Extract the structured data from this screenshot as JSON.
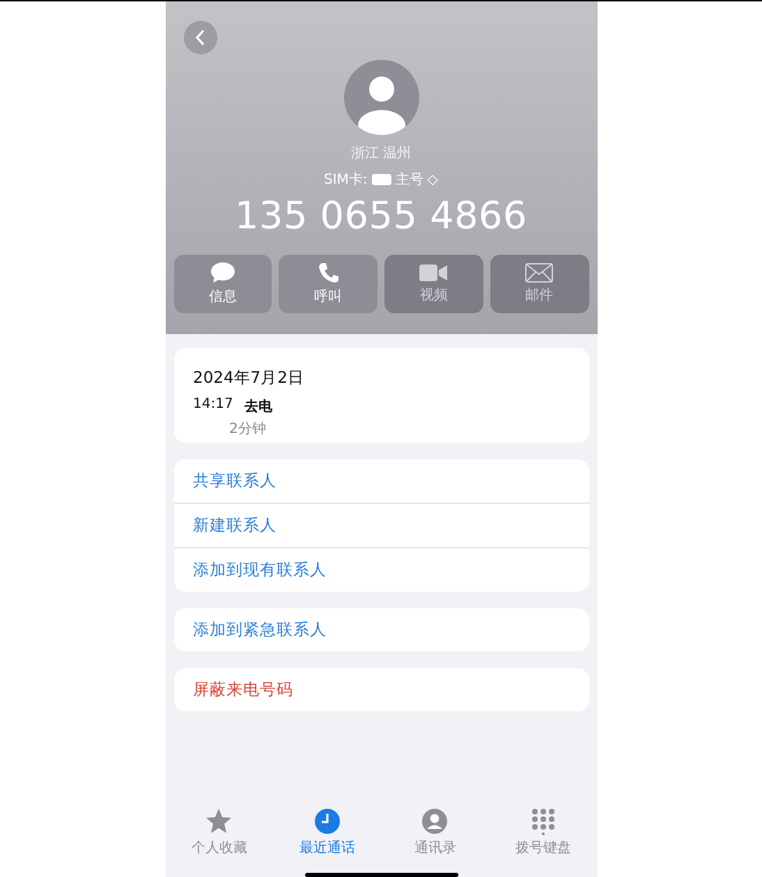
{
  "header": {
    "location": "浙江 温州",
    "sim_label": "SIM卡:",
    "sim_line": "主号",
    "sim_switch": "◇",
    "number": "135 0655 4866"
  },
  "actions": [
    {
      "kind": "message",
      "label": "信息",
      "disabled": false
    },
    {
      "kind": "call",
      "label": "呼叫",
      "disabled": false
    },
    {
      "kind": "video",
      "label": "视频",
      "disabled": true
    },
    {
      "kind": "mail",
      "label": "邮件",
      "disabled": true
    }
  ],
  "call_log": {
    "date": "2024年7月2日",
    "entries": [
      {
        "time": "14:17",
        "type": "去电",
        "duration": "2分钟"
      }
    ]
  },
  "groups": [
    [
      {
        "label": "共享联系人",
        "kind": "normal"
      },
      {
        "label": "新建联系人",
        "kind": "normal"
      },
      {
        "label": "添加到现有联系人",
        "kind": "normal"
      }
    ],
    [
      {
        "label": "添加到紧急联系人",
        "kind": "normal"
      }
    ],
    [
      {
        "label": "屏蔽来电号码",
        "kind": "danger"
      }
    ]
  ],
  "tabs": [
    {
      "kind": "favorites",
      "label": "个人收藏",
      "selected": false
    },
    {
      "kind": "recents",
      "label": "最近通话",
      "selected": true
    },
    {
      "kind": "contacts",
      "label": "通讯录",
      "selected": false
    },
    {
      "kind": "keypad",
      "label": "拨号键盘",
      "selected": false
    }
  ]
}
